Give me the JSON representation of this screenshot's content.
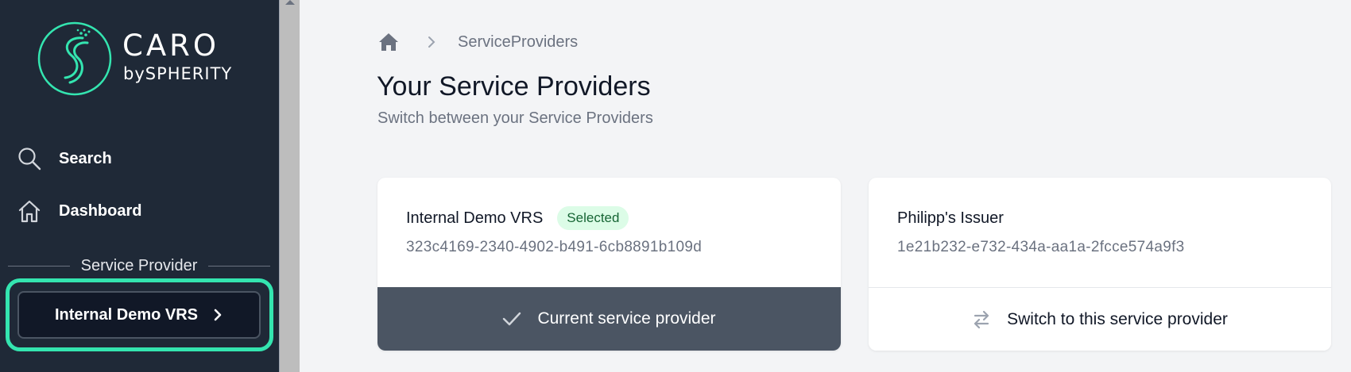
{
  "brand": {
    "name": "CARO",
    "byline": "bySPHERITY",
    "accent_color": "#34e5b0"
  },
  "sidebar": {
    "nav": [
      {
        "label": "Search",
        "icon": "search-icon"
      },
      {
        "label": "Dashboard",
        "icon": "home-icon"
      }
    ],
    "section_title": "Service Provider",
    "current_provider_button": "Internal Demo VRS"
  },
  "breadcrumb": {
    "home_icon": "home-icon",
    "current": "ServiceProviders"
  },
  "page": {
    "title": "Your Service Providers",
    "subtitle": "Switch between your Service Providers"
  },
  "providers": [
    {
      "name": "Internal Demo VRS",
      "badge": "Selected",
      "id": "323c4169-2340-4902-b491-6cb8891b109d",
      "action": "Current service provider",
      "action_icon": "check-icon"
    },
    {
      "name": "Philipp's Issuer",
      "id": "1e21b232-e732-434a-aa1a-2fcce574a9f3",
      "action": "Switch to this service provider",
      "action_icon": "switch-arrows-icon"
    }
  ]
}
